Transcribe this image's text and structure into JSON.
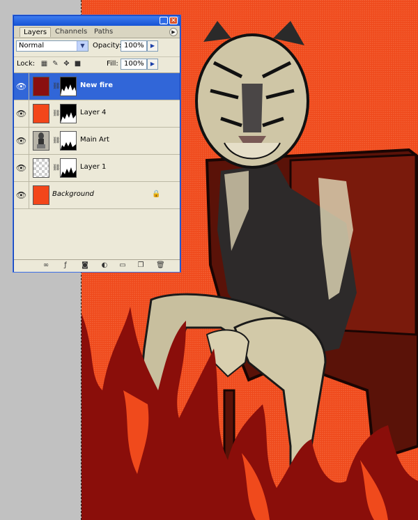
{
  "panel": {
    "tabs": [
      "Layers",
      "Channels",
      "Paths"
    ],
    "active_tab": "Layers",
    "blend_mode": "Normal",
    "opacity_label": "Opacity:",
    "opacity_value": "100%",
    "lock_label": "Lock:",
    "fill_label": "Fill:",
    "fill_value": "100%",
    "layers": [
      {
        "name": "New fire",
        "selected": true,
        "thumb_color": "#8a0f0f"
      },
      {
        "name": "Layer 4",
        "selected": false,
        "thumb_color": "#f3461a"
      },
      {
        "name": "Main Art",
        "selected": false,
        "thumb_color": "#9a9a9a"
      },
      {
        "name": "Layer 1",
        "selected": false,
        "thumb_color": "transparent"
      },
      {
        "name": "Background",
        "selected": false,
        "thumb_color": "#f3461a",
        "locked": true
      }
    ]
  },
  "colors": {
    "canvas_orange": "#ef4a1c",
    "fire_dark_red": "#8a0e0a",
    "selection_blue": "#3166d8",
    "titlebar_blue": "#1653d4"
  },
  "icons": {
    "footer": [
      "link-layers-icon",
      "layer-style-icon",
      "add-mask-icon",
      "adjustment-layer-icon",
      "new-group-icon",
      "new-layer-icon",
      "delete-layer-icon"
    ]
  }
}
